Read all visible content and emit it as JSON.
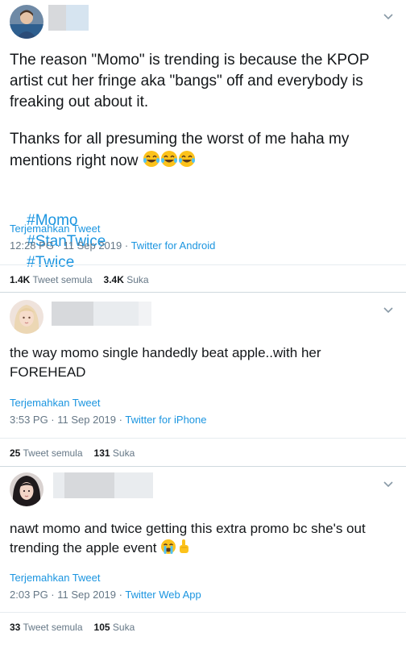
{
  "tweets": [
    {
      "text": "The reason \"Momo\" is trending is because the KPOP artist cut her fringe aka \"bangs\" off and everybody is freaking out about it.",
      "text2": "Thanks for all presuming the worst of me haha my mentions right now",
      "emoji": [
        "face-with-tears-of-joy",
        "face-with-tears-of-joy",
        "face-with-tears-of-joy"
      ],
      "hashtags": [
        "#Momo",
        "#StanTwice",
        "#Twice"
      ],
      "translate": "Terjemahkan Tweet",
      "time": "12:28 PG · 11 Sep 2019 · ",
      "source": "Twitter for Android",
      "retweets_count": "1.4K",
      "retweets_label": "Tweet semula",
      "likes_count": "3.4K",
      "likes_label": "Suka"
    },
    {
      "text": "the way momo single handedly beat apple..with her FOREHEAD",
      "translate": "Terjemahkan Tweet",
      "time": "3:53 PG · 11 Sep 2019 · ",
      "source": "Twitter for iPhone",
      "retweets_count": "25",
      "retweets_label": "Tweet semula",
      "likes_count": "131",
      "likes_label": "Suka"
    },
    {
      "text": "nawt momo and twice getting this extra promo bc she's out trending the apple event",
      "emoji": [
        "loudly-crying-face",
        "index-pointing-up"
      ],
      "translate": "Terjemahkan Tweet",
      "time": "2:03 PG · 11 Sep 2019 · ",
      "source": "Twitter Web App",
      "retweets_count": "33",
      "retweets_label": "Tweet semula",
      "likes_count": "105",
      "likes_label": "Suka"
    }
  ],
  "colors": {
    "link": "#1b95e0",
    "meta": "#657786",
    "text": "#14171a",
    "divider": "#e6ecf0"
  }
}
